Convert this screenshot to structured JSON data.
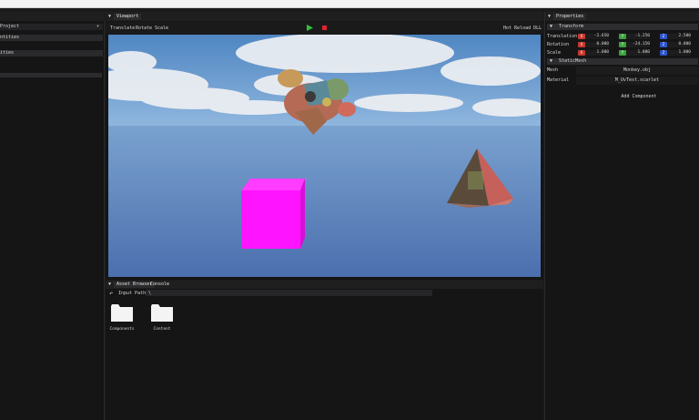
{
  "left_panel": {
    "project_label": "Project",
    "entities_label": "ntities",
    "section2_label": "ities"
  },
  "viewport": {
    "tab": "Viewport",
    "toolbar": {
      "translate": "Translate",
      "rotate": "Rotate",
      "scale": "Scale",
      "hot_reload": "Hot Reload DLL"
    }
  },
  "properties": {
    "tab": "Properties",
    "transform_header": "Transform",
    "rows": [
      {
        "label": "Translation",
        "x": "-2.650",
        "y": "-1.250",
        "z": "2.500"
      },
      {
        "label": "Rotation",
        "x": "0.000",
        "y": "-24.150",
        "z": "0.000"
      },
      {
        "label": "Scale",
        "x": "1.000",
        "y": "1.000",
        "z": "1.000"
      }
    ],
    "axis": {
      "x": "X",
      "y": "Y",
      "z": "Z"
    },
    "static_mesh_header": "StaticMesh",
    "mesh_label": "Mesh",
    "mesh_value": "Monkey.obj",
    "material_label": "Material",
    "material_value": "M_UvTest.scarlet",
    "add_component": "Add Component"
  },
  "bottom": {
    "tabs": {
      "asset_browser": "Asset Browser",
      "console": "Console"
    },
    "input_path_label": "Input Path:",
    "input_path_value": "\\",
    "folders": [
      "Components",
      "Content"
    ]
  },
  "colors": {
    "magenta_cube": "#ff14ff",
    "play": "#35c13a",
    "stop": "#e0232d"
  }
}
